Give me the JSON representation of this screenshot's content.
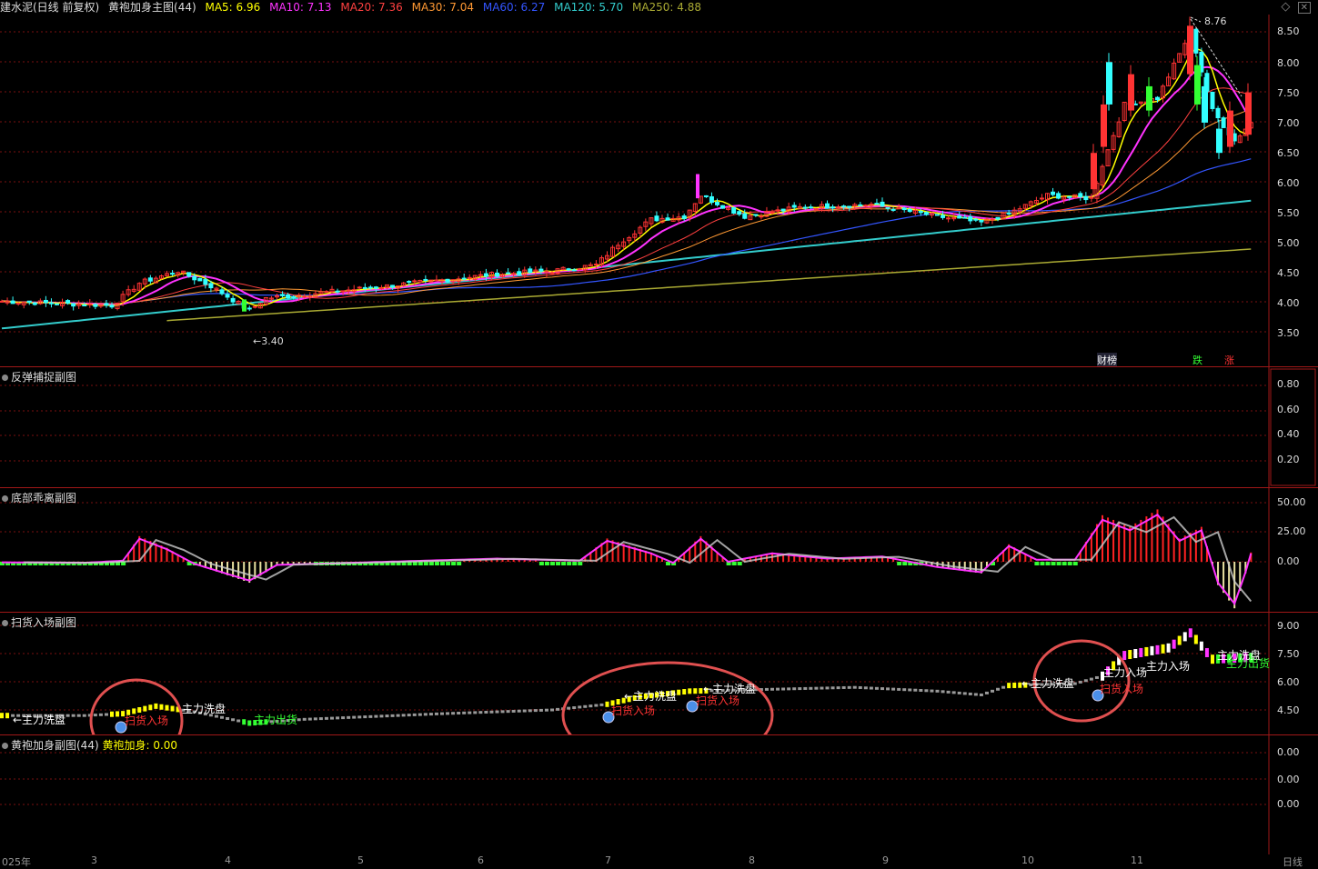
{
  "header": {
    "stock": "建水泥(日线 前复权)",
    "indicator": "黄袍加身主图(44)",
    "ma": [
      {
        "label": "MA5: 6.96",
        "color": "#ffff00"
      },
      {
        "label": "MA10: 7.13",
        "color": "#ff33ff"
      },
      {
        "label": "MA20: 7.36",
        "color": "#ff4040"
      },
      {
        "label": "MA30: 7.04",
        "color": "#ff9933"
      },
      {
        "label": "MA60: 6.27",
        "color": "#3355ff"
      },
      {
        "label": "MA120: 5.70",
        "color": "#33cccc"
      },
      {
        "label": "MA250: 4.88",
        "color": "#aaaa33"
      }
    ]
  },
  "main_panel": {
    "y_ticks": [
      "8.50",
      "8.00",
      "7.50",
      "7.00",
      "6.50",
      "6.00",
      "5.50",
      "5.00",
      "4.50",
      "4.00",
      "3.50"
    ],
    "high_label": "8.76",
    "low_label": "←3.40",
    "markers": [
      {
        "text": "财榜",
        "color": "#ffffff"
      },
      {
        "text": "跌",
        "color": "#33ff33"
      },
      {
        "text": "涨",
        "color": "#ff3333"
      }
    ]
  },
  "panel_rebound": {
    "title": "反弹捕捉副图",
    "y_ticks": [
      "0.80",
      "0.60",
      "0.40",
      "0.20"
    ]
  },
  "panel_bottom_div": {
    "title": "底部乖离副图",
    "y_ticks": [
      "50.00",
      "25.00",
      "0.00"
    ]
  },
  "panel_sweep": {
    "title": "扫货入场副图",
    "y_ticks": [
      "9.00",
      "7.50",
      "6.00",
      "4.50"
    ],
    "labels": {
      "wash": "主力洗盘",
      "wash_arrow": "←主力洗盘",
      "enter": "扫货入场",
      "out": "主力出货",
      "enter_arrow": "主力入场"
    }
  },
  "panel_hpjs": {
    "title": "黄袍加身副图(44)",
    "value_label": "黄袍加身: 0.00",
    "y_ticks": [
      "0.00",
      "0.00",
      "0.00"
    ]
  },
  "x_axis": {
    "labels": [
      "025年",
      "3",
      "4",
      "5",
      "6",
      "7",
      "8",
      "9",
      "10",
      "11",
      "日线"
    ]
  },
  "colors": {
    "up": "#ff3333",
    "down": "#33ffff",
    "grid": "#8a1010",
    "circle": "#e05050"
  }
}
